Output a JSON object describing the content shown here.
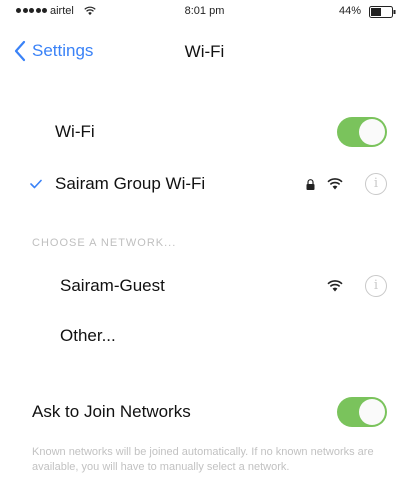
{
  "status_bar": {
    "carrier": "airtel",
    "time": "8:01 pm",
    "battery": "44%"
  },
  "nav": {
    "back_label": "Settings",
    "title": "Wi-Fi"
  },
  "wifi_row": {
    "label": "Wi-Fi",
    "enabled": true
  },
  "connected_network": {
    "name": "Sairam Group Wi-Fi",
    "icons": [
      "check-icon",
      "lock-icon",
      "wifi-icon",
      "info-icon"
    ]
  },
  "section": {
    "header": "CHOOSE A NETWORK..."
  },
  "networks": [
    {
      "name": "Sairam-Guest",
      "icons": [
        "wifi-icon",
        "info-icon"
      ]
    },
    {
      "name": "Other..."
    }
  ],
  "ask_to_join": {
    "label": "Ask to Join Networks",
    "enabled": true
  },
  "footer": {
    "text": "Known networks will be joined automatically. If no known networks are available, you will have to manually select a network."
  },
  "colors": {
    "accent": "#3a82f7",
    "toggle_on": "#7ac35c",
    "secondary_text": "#bfbfbf"
  }
}
